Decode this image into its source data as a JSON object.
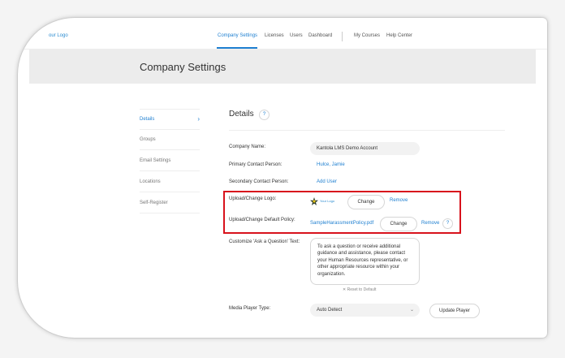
{
  "header": {
    "logo_text": "our Logo",
    "nav": [
      "Company Settings",
      "Licenses",
      "Users",
      "Dashboard",
      "My Courses",
      "Help Center"
    ]
  },
  "page": {
    "title": "Company Settings"
  },
  "sidebar": {
    "items": [
      {
        "label": "Details",
        "active": true
      },
      {
        "label": "Groups"
      },
      {
        "label": "Email Settings"
      },
      {
        "label": "Locations"
      },
      {
        "label": "Self-Register"
      }
    ]
  },
  "details": {
    "title": "Details",
    "help_icon": "?",
    "company_name_label": "Company Name:",
    "company_name_value": "Kantola LMS Demo Account",
    "primary_contact_label": "Primary Contact Person:",
    "primary_contact_value": "Hulce, Jamie",
    "secondary_contact_label": "Secondary Contact Person:",
    "secondary_contact_action": "Add User",
    "logo_label": "Upload/Change Logo:",
    "logo_preview_text": "Your Logo",
    "logo_change": "Change",
    "logo_remove": "Remove",
    "policy_label": "Upload/Change Default Policy:",
    "policy_file": "SampleHarassmentPolicy.pdf",
    "policy_change": "Change",
    "policy_remove": "Remove",
    "policy_help": "?",
    "ask_label": "Customize 'Ask a Question' Text:",
    "ask_text": "To ask a question or receive additional guidance and assistance, please contact your Human Resources representative, or other appropriate resource within your organization.",
    "reset_label": "Reset to Default",
    "media_label": "Media Player Type:",
    "media_value": "Auto Detect",
    "update_player": "Update Player"
  },
  "colors": {
    "accent": "#1e7fd0",
    "highlight": "#d8121c"
  }
}
